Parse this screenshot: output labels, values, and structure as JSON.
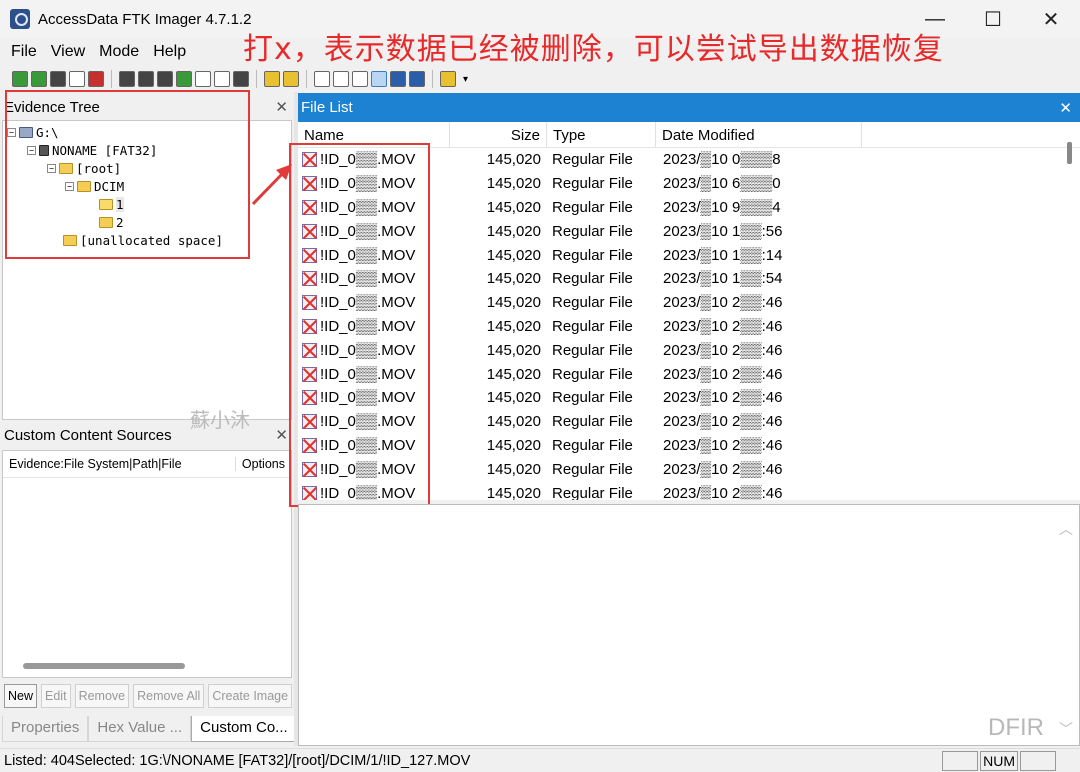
{
  "window": {
    "title": "AccessData FTK Imager 4.7.1.2",
    "minimize": "—",
    "maximize": "☐",
    "close": "✕"
  },
  "menu": [
    "File",
    "View",
    "Mode",
    "Help"
  ],
  "annotation": "打x，表示数据已经被删除，可以尝试导出数据恢复",
  "evidence_tree": {
    "title": "Evidence Tree",
    "items": [
      {
        "label": "G:\\"
      },
      {
        "label": "NONAME [FAT32]"
      },
      {
        "label": "[root]"
      },
      {
        "label": "DCIM"
      },
      {
        "label": "1"
      },
      {
        "label": "2"
      },
      {
        "label": "[unallocated space]"
      }
    ]
  },
  "watermark": "蘇小沐",
  "custom_sources": {
    "title": "Custom Content Sources",
    "col_evidence": "Evidence:File System|Path|File",
    "col_options": "Options",
    "buttons": [
      "New",
      "Edit",
      "Remove",
      "Remove All",
      "Create Image"
    ]
  },
  "bottom_tabs": [
    "Properties",
    "Hex Value ...",
    "Custom Co..."
  ],
  "file_list": {
    "title": "File List",
    "columns": [
      "Name",
      "Size",
      "Type",
      "Date Modified"
    ],
    "rows": [
      {
        "name": "!ID_0▒▒.MOV",
        "size": "145,020",
        "type": "Regular File",
        "date": "2023/▒10 0▒▒▒8"
      },
      {
        "name": "!ID_0▒▒.MOV",
        "size": "145,020",
        "type": "Regular File",
        "date": "2023/▒10 6▒▒▒0"
      },
      {
        "name": "!ID_0▒▒.MOV",
        "size": "145,020",
        "type": "Regular File",
        "date": "2023/▒10 9▒▒▒4"
      },
      {
        "name": "!ID_0▒▒.MOV",
        "size": "145,020",
        "type": "Regular File",
        "date": "2023/▒10 1▒▒:56"
      },
      {
        "name": "!ID_0▒▒.MOV",
        "size": "145,020",
        "type": "Regular File",
        "date": "2023/▒10 1▒▒:14"
      },
      {
        "name": "!ID_0▒▒.MOV",
        "size": "145,020",
        "type": "Regular File",
        "date": "2023/▒10 1▒▒:54"
      },
      {
        "name": "!ID_0▒▒.MOV",
        "size": "145,020",
        "type": "Regular File",
        "date": "2023/▒10 2▒▒:46"
      },
      {
        "name": "!ID_0▒▒.MOV",
        "size": "145,020",
        "type": "Regular File",
        "date": "2023/▒10 2▒▒:46"
      },
      {
        "name": "!ID_0▒▒.MOV",
        "size": "145,020",
        "type": "Regular File",
        "date": "2023/▒10 2▒▒:46"
      },
      {
        "name": "!ID_0▒▒.MOV",
        "size": "145,020",
        "type": "Regular File",
        "date": "2023/▒10 2▒▒:46"
      },
      {
        "name": "!ID_0▒▒.MOV",
        "size": "145,020",
        "type": "Regular File",
        "date": "2023/▒10 2▒▒:46"
      },
      {
        "name": "!ID_0▒▒.MOV",
        "size": "145,020",
        "type": "Regular File",
        "date": "2023/▒10 2▒▒:46"
      },
      {
        "name": "!ID_0▒▒.MOV",
        "size": "145,020",
        "type": "Regular File",
        "date": "2023/▒10 2▒▒:46"
      },
      {
        "name": "!ID_0▒▒.MOV",
        "size": "145,020",
        "type": "Regular File",
        "date": "2023/▒10 2▒▒:46"
      },
      {
        "name": "!ID_0▒▒.MOV",
        "size": "145,020",
        "type": "Regular File",
        "date": "2023/▒10 2▒▒:46"
      }
    ]
  },
  "dfir_mark": "DFIR",
  "status": {
    "text": "Listed: 404Selected: 1G:\\/NONAME [FAT32]/[root]/DCIM/1/!ID_127.MOV",
    "num": "NUM"
  },
  "colors": {
    "accent": "#1e82d2",
    "annotation_red": "#e8292a"
  }
}
